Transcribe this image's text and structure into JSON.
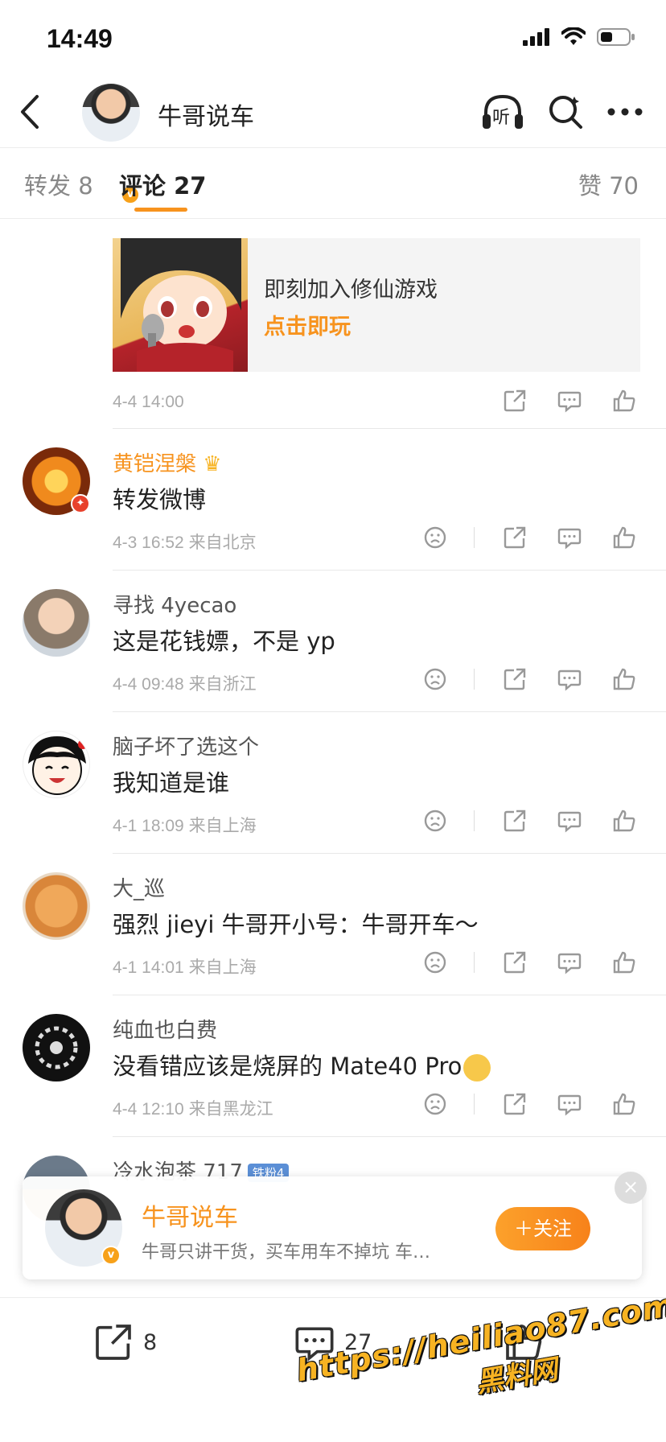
{
  "status_bar": {
    "time": "14:49"
  },
  "nav": {
    "title": "牛哥说车",
    "verified_badge": "v",
    "listen_label": "听"
  },
  "tabs": [
    {
      "label": "转发 8"
    },
    {
      "label": "评论 27"
    },
    {
      "label": "赞 70"
    }
  ],
  "ad": {
    "line1": "即刻加入修仙游戏",
    "line2": "点击即玩",
    "time": "4-4 14:00"
  },
  "comments": [
    {
      "name": "黄铠涅槃",
      "text": "转发微博",
      "meta": "4-3 16:52  来自北京"
    },
    {
      "name": "寻找 4yecao",
      "text": "这是花钱嫖，不是 yp",
      "meta": "4-4 09:48  来自浙江"
    },
    {
      "name": "脑子坏了选这个",
      "text": "我知道是谁",
      "meta": "4-1 18:09  来自上海"
    },
    {
      "name": "大_巡",
      "text": "强烈 jieyi 牛哥开小号：牛哥开车～",
      "meta": "4-1 14:01  来自上海"
    },
    {
      "name": "纯血也白费",
      "text": "没看错应该是烧屏的 Mate40 Pro",
      "meta": "4-4 12:10  来自黑龙江"
    },
    {
      "name": "冷水泡茶 717",
      "badge": "铁粉4"
    }
  ],
  "popup": {
    "name": "牛哥说车",
    "desc": "牛哥只讲干货，买车用车不掉坑 车…",
    "follow_label": "＋关注",
    "close": "×"
  },
  "bottom_bar": {
    "repost_count": "8",
    "comment_count": "27"
  },
  "watermark": {
    "line1": "https://heiliao87.com",
    "line2": "黑料网"
  },
  "colors": {
    "accent": "#f7931e",
    "text": "#222222",
    "muted": "#aaaaaa"
  }
}
